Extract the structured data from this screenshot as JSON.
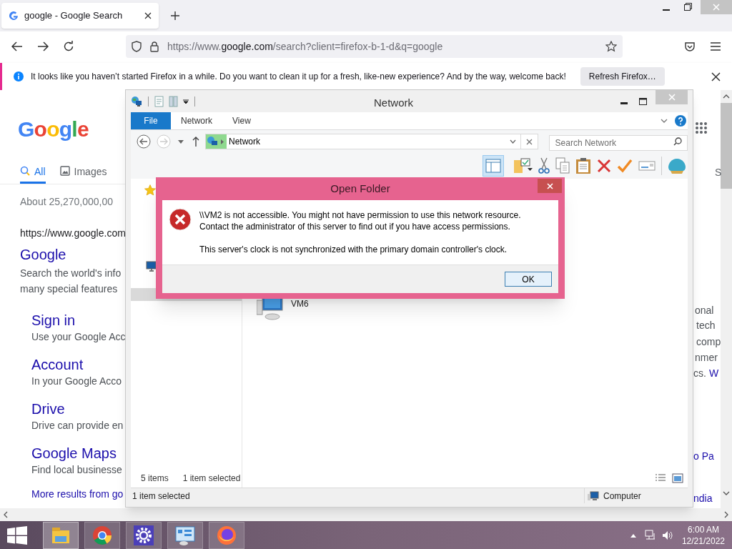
{
  "browser": {
    "tabs": [
      {
        "title": "google - Google Search",
        "selected": true
      }
    ],
    "url": {
      "prefix": "https://www.",
      "host": "google.com",
      "rest": "/search?client=firefox-b-1-d&q=google"
    },
    "notification": {
      "message": "It looks like you haven’t started Firefox in a while. Do you want to clean it up for a fresh, like-new experience? And by the way, welcome back!",
      "button": "Refresh Firefox…"
    }
  },
  "google_page": {
    "logo": "Google",
    "tabs": [
      {
        "label": "All",
        "selected": true
      },
      {
        "label": "Images",
        "selected": false
      }
    ],
    "result_stats": "About 25,270,000,00",
    "result": {
      "url": "https://www.google.com",
      "title": "Google",
      "snippet": [
        "Search the world's info",
        "many special features"
      ]
    },
    "sitelinks": [
      {
        "title": "Sign in",
        "snippet": "Use your Google Acc"
      },
      {
        "title": "Account",
        "snippet": "In your Google Acco"
      },
      {
        "title": "Drive",
        "snippet": "Drive can provide en"
      },
      {
        "title": "Google Maps",
        "snippet": "Find local businesse"
      }
    ],
    "more_results": "More results from go",
    "right_fragments": [
      {
        "kind": "tab",
        "text": "S"
      },
      {
        "kind": "text",
        "text": "onal"
      },
      {
        "kind": "text",
        "text": "tech"
      },
      {
        "kind": "text",
        "text": "comp"
      },
      {
        "kind": "text",
        "text": "nmer"
      },
      {
        "kind": "text",
        "text": "cs."
      },
      {
        "kind": "link",
        "text": "W"
      },
      {
        "kind": "link",
        "text": "o Pa"
      },
      {
        "kind": "link",
        "text": "ndia"
      }
    ]
  },
  "explorer": {
    "title": "Network",
    "ribbon_tabs": [
      {
        "label": "File",
        "selected": true
      },
      {
        "label": "Network",
        "selected": false
      },
      {
        "label": "View",
        "selected": false
      }
    ],
    "address": "Network",
    "search": {
      "placeholder": "Search Network"
    },
    "items": [
      {
        "name": "VM6"
      }
    ],
    "status": {
      "count": "5 items",
      "selection": "1 item selected"
    },
    "footer": {
      "selection": "1 item selected",
      "zone": "Computer"
    }
  },
  "dialog": {
    "title": "Open Folder",
    "message": [
      "\\\\VM2 is not accessible. You might not have permission to use this network resource. Contact the administrator of this server to find out if you have access permissions.",
      "This server's clock is not synchronized with the primary domain controller's clock."
    ],
    "button": "OK"
  },
  "taskbar": {
    "apps": [
      {
        "kind": "files"
      },
      {
        "kind": "chrome"
      },
      {
        "kind": "settings"
      },
      {
        "kind": "control"
      },
      {
        "kind": "firefox"
      }
    ],
    "time": "6:00 AM",
    "date": "12/21/2022"
  }
}
